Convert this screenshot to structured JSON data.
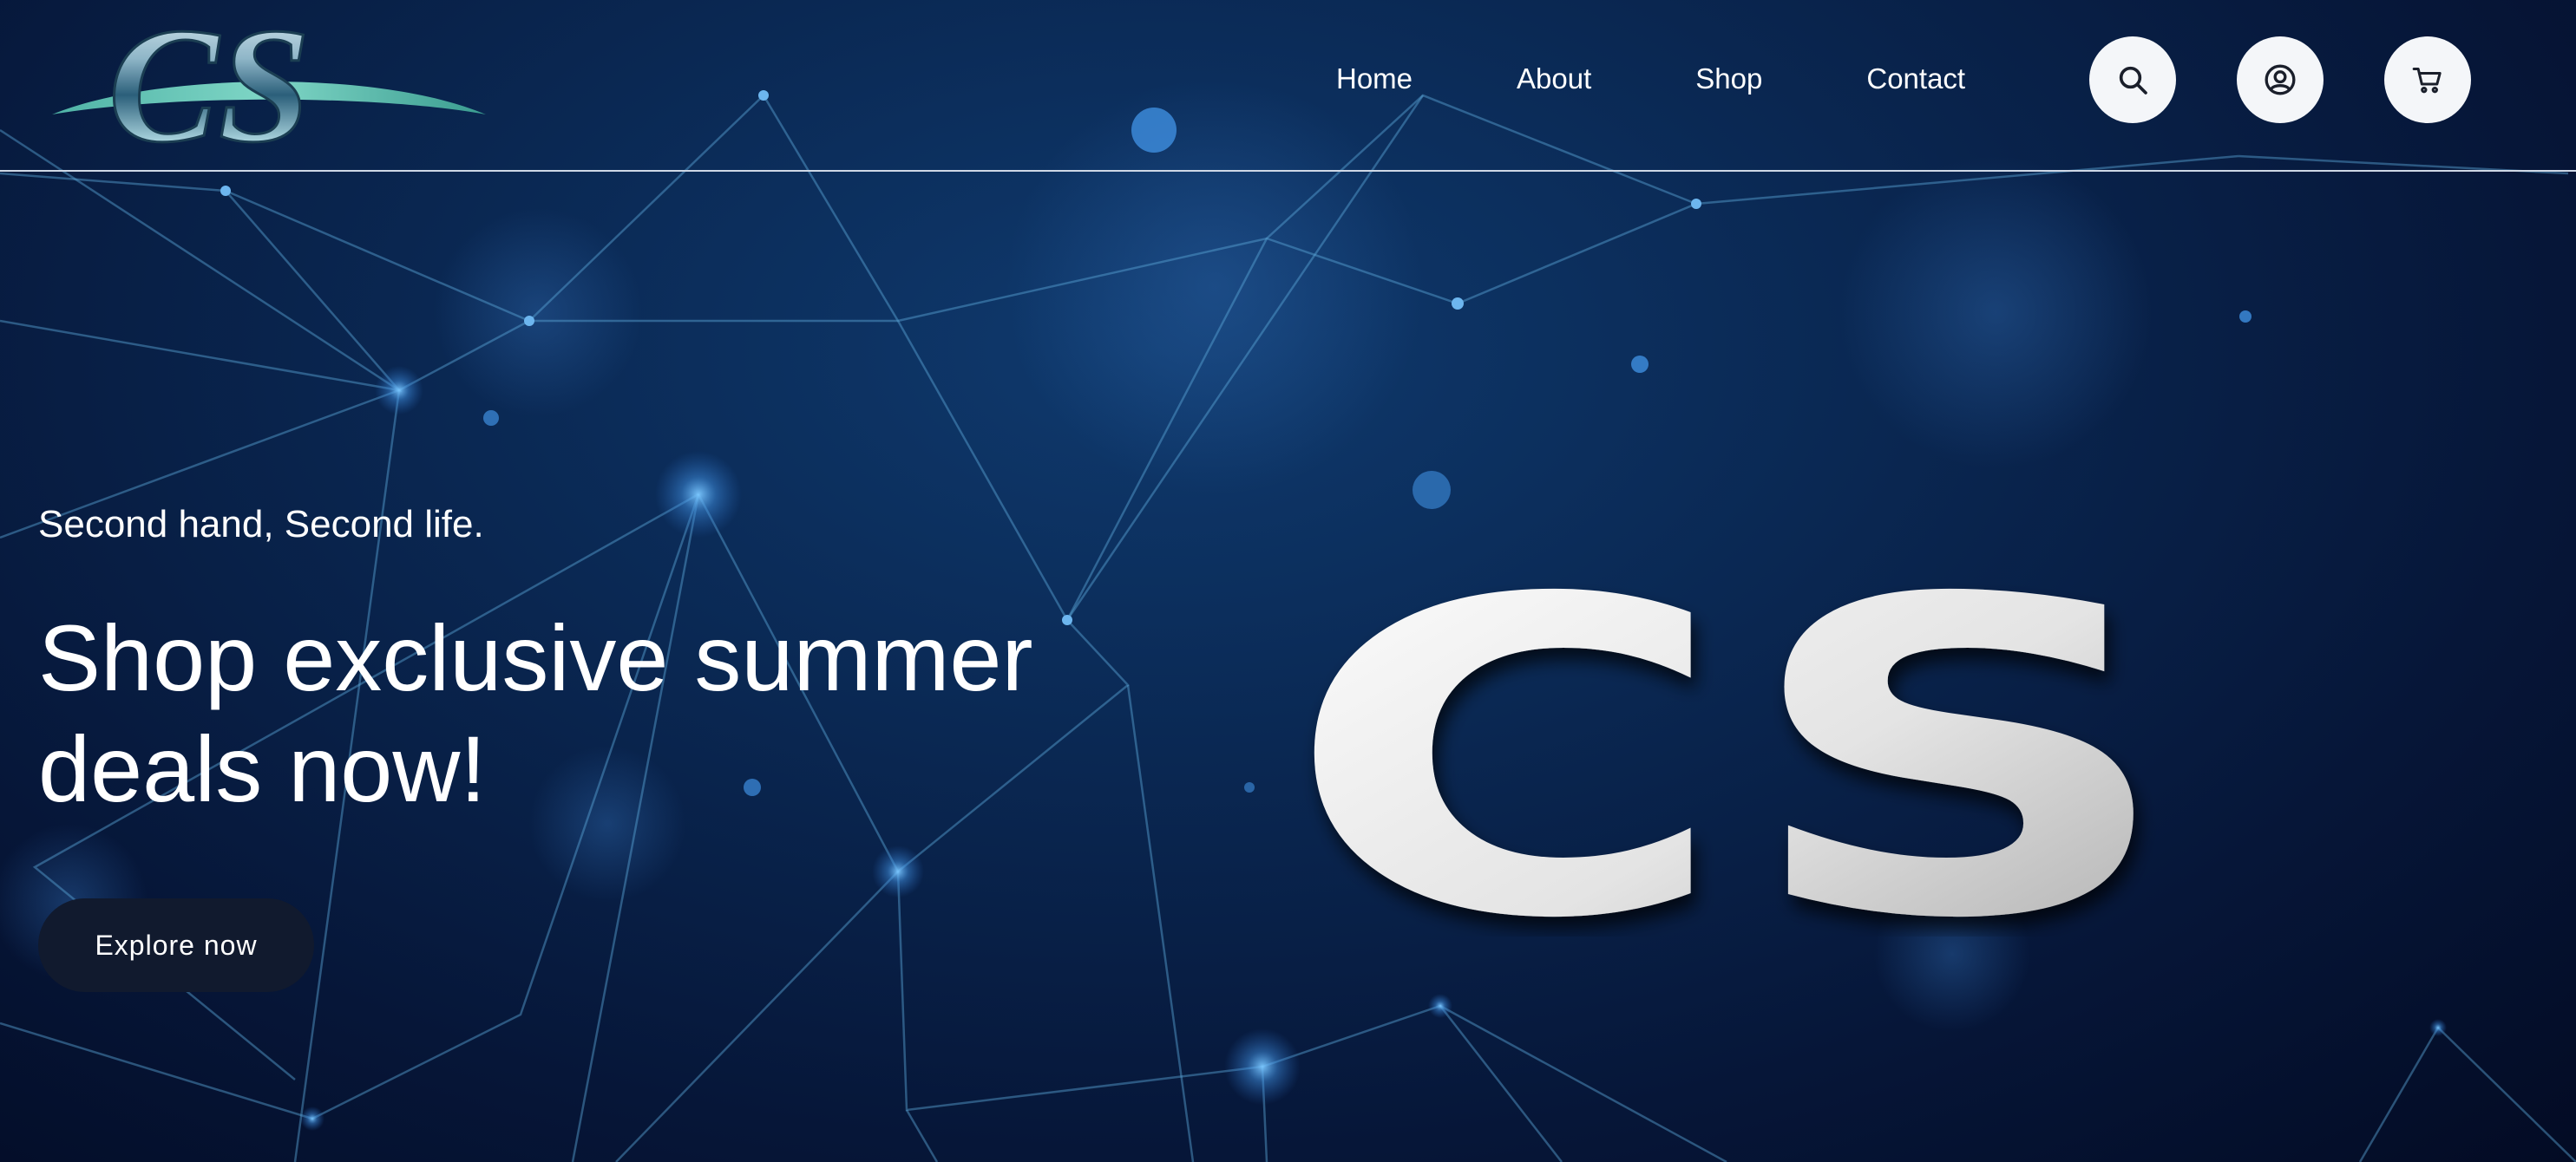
{
  "header": {
    "logo": {
      "text": "CS",
      "icon": "cs-chrome-logo"
    },
    "nav": [
      {
        "label": "Home"
      },
      {
        "label": "About"
      },
      {
        "label": "Shop"
      },
      {
        "label": "Contact"
      }
    ],
    "icons": [
      "search-icon",
      "account-icon",
      "cart-icon"
    ]
  },
  "hero": {
    "tagline": "Second hand, Second life.",
    "headline": "Shop exclusive summer deals now!",
    "cta_label": "Explore now",
    "image_text": "CS"
  },
  "colors": {
    "background": "#061638",
    "accent": "#4aa8f0",
    "button": "#111a2e",
    "text": "#ffffff"
  }
}
